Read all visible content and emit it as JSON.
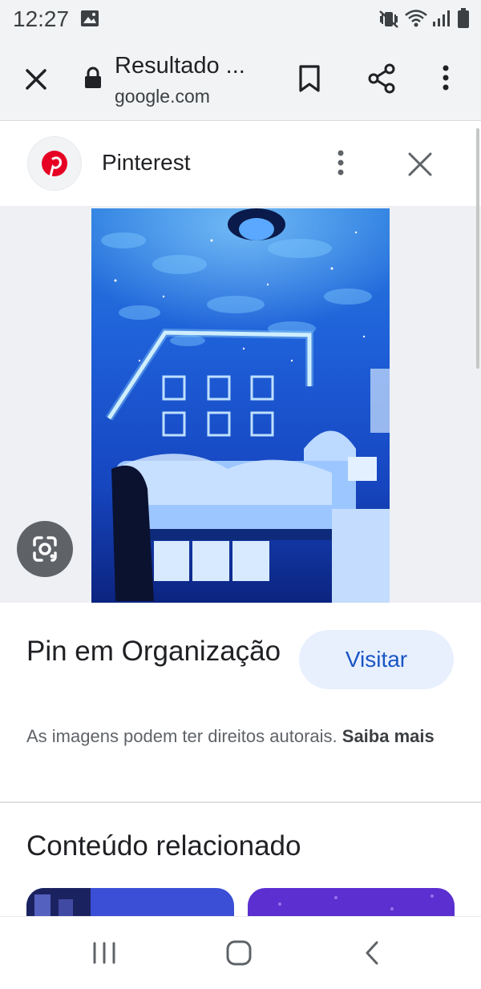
{
  "status_bar": {
    "time": "12:27"
  },
  "toolbar": {
    "title": "Resultado ...",
    "url": "google.com",
    "icons": [
      "close-icon",
      "lock-icon",
      "bookmark-icon",
      "share-icon",
      "more-vert-icon"
    ]
  },
  "source": {
    "name": "Pinterest",
    "logo_color": "#e60023"
  },
  "pin": {
    "title": "Pin em Organização",
    "visit_label": "Visitar",
    "rights_text": "As imagens podem ter direitos autorais.",
    "learn_more": "Saiba mais"
  },
  "related": {
    "heading": "Conteúdo relacionado"
  },
  "colors": {
    "accent": "#1a56c4",
    "visit_bg": "#e8f0fe",
    "toolbar_bg": "#f1f3f4"
  }
}
